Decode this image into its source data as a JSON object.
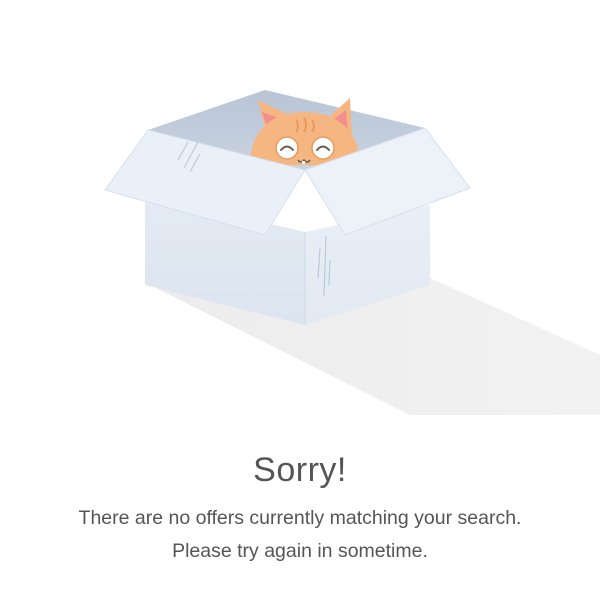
{
  "empty_state": {
    "title": "Sorry!",
    "message": "There are no offers currently matching your search. Please try again in sometime.",
    "illustration": "cat-peeking-from-box-icon"
  },
  "colors": {
    "text": "#555555",
    "background": "#ffffff",
    "box_light": "#eef3f9",
    "box_mid": "#dde6f1",
    "box_dark": "#c9d6e6",
    "cat_orange": "#f6b682",
    "shadow": "#ebebeb"
  }
}
